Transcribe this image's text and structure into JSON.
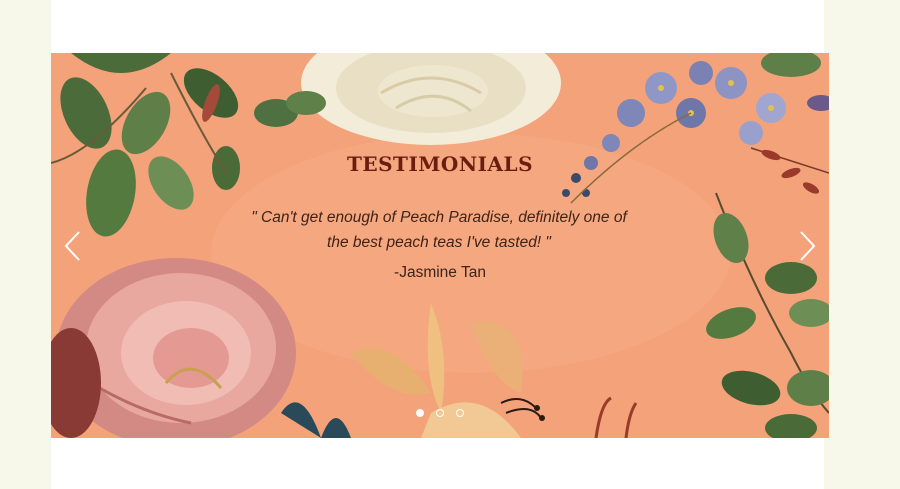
{
  "testimonials": {
    "title": "TESTIMONIALS",
    "quote": "\" Can't get enough of Peach Paradise, definitely one of the best peach teas I've tasted! \"",
    "author": "-Jasmine Tan",
    "slide_count": 3,
    "active_slide": 1,
    "prev_icon": "chevron-left-icon",
    "next_icon": "chevron-right-icon"
  },
  "colors": {
    "background": "#f4a27a",
    "title": "#6b1d10",
    "text": "#3d2318",
    "page": "#f8f8ea"
  }
}
